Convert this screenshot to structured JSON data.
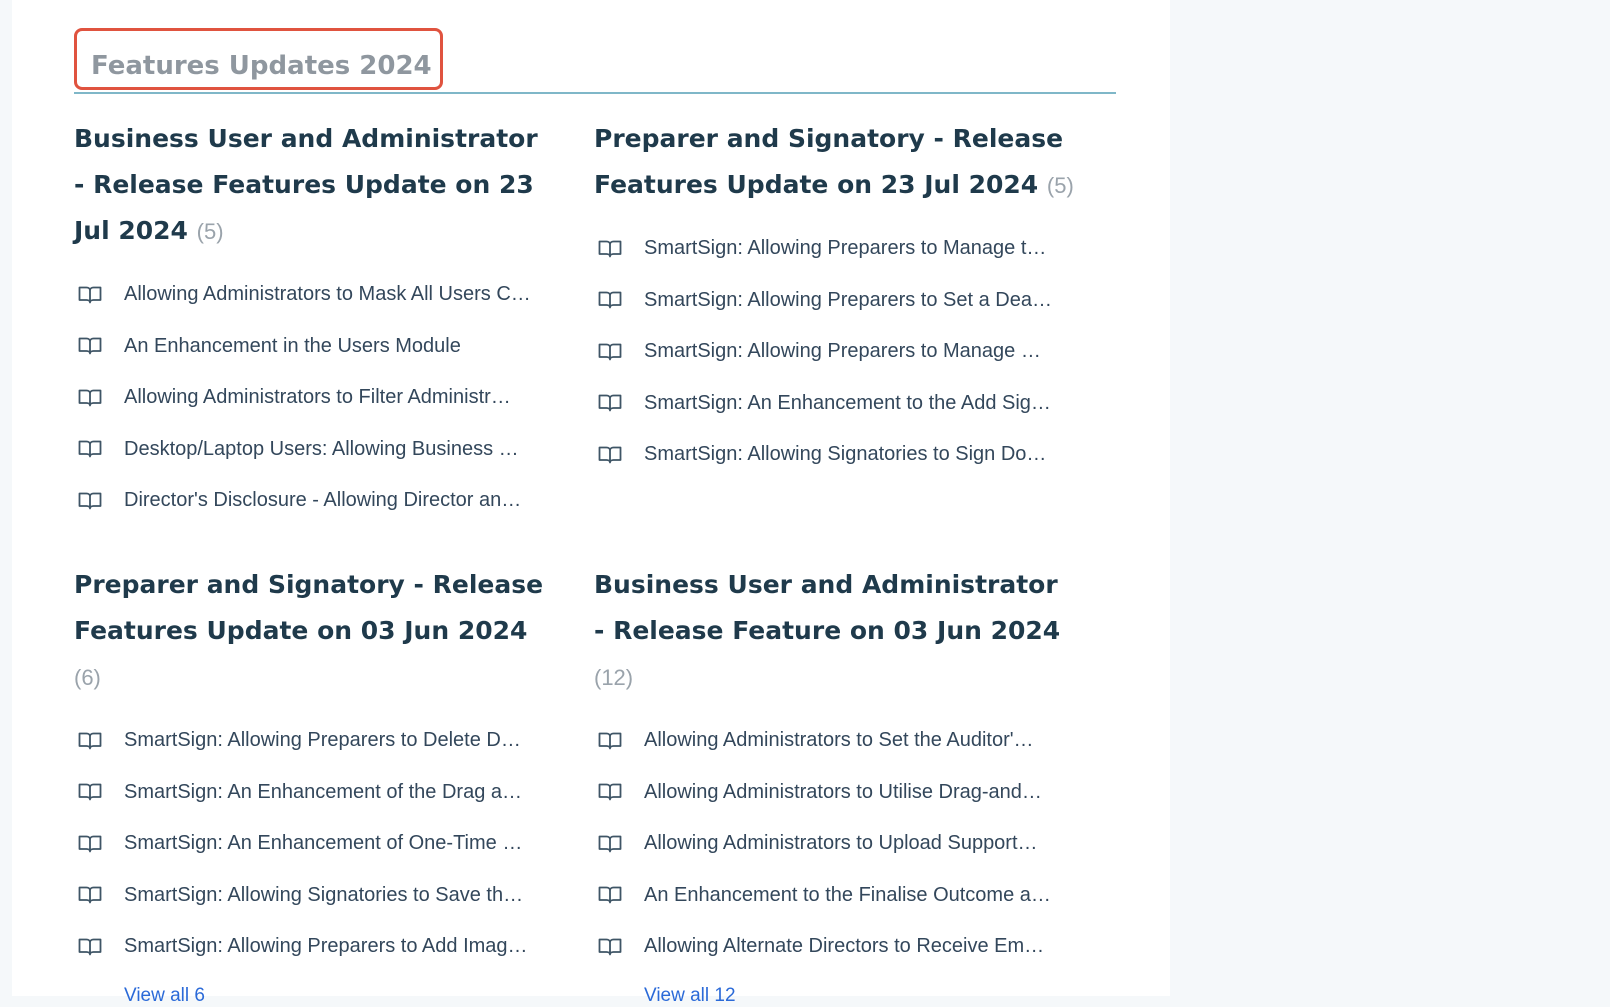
{
  "section": {
    "title": "Features Updates 2024"
  },
  "categories": [
    {
      "title": "Business User and Administrator - Release Features Update on 23 Jul 2024",
      "count": "(5)",
      "articles": [
        "Allowing Administrators to Mask All Users C…",
        "An Enhancement in the Users Module",
        "Allowing Administrators to Filter Administr…",
        "Desktop/Laptop Users: Allowing Business …",
        "Director's Disclosure - Allowing Director an…"
      ],
      "view_all": ""
    },
    {
      "title": "Preparer and Signatory - Release Features Update on 23 Jul 2024",
      "count": "(5)",
      "articles": [
        "SmartSign: Allowing Preparers to Manage t…",
        "SmartSign: Allowing Preparers to Set a Dea…",
        "SmartSign: Allowing Preparers to Manage …",
        "SmartSign: An Enhancement to the Add Sig…",
        "SmartSign: Allowing Signatories to Sign Do…"
      ],
      "view_all": ""
    },
    {
      "title": "Preparer and Signatory - Release Features Update on 03 Jun 2024",
      "count": "(6)",
      "articles": [
        "SmartSign: Allowing Preparers to Delete D…",
        "SmartSign: An Enhancement of the Drag a…",
        "SmartSign: An Enhancement of One-Time …",
        "SmartSign: Allowing Signatories to Save th…",
        "SmartSign: Allowing Preparers to Add Imag…"
      ],
      "view_all": "View all 6"
    },
    {
      "title": "Business User and Administrator - Release Feature on 03 Jun 2024",
      "count": "(12)",
      "articles": [
        "Allowing Administrators to Set the Auditor'…",
        "Allowing Administrators to Utilise Drag-and…",
        "Allowing Administrators to Upload Support…",
        "An Enhancement to the Finalise Outcome a…",
        "Allowing Alternate Directors to Receive Em…"
      ],
      "view_all": "View all 12"
    }
  ]
}
